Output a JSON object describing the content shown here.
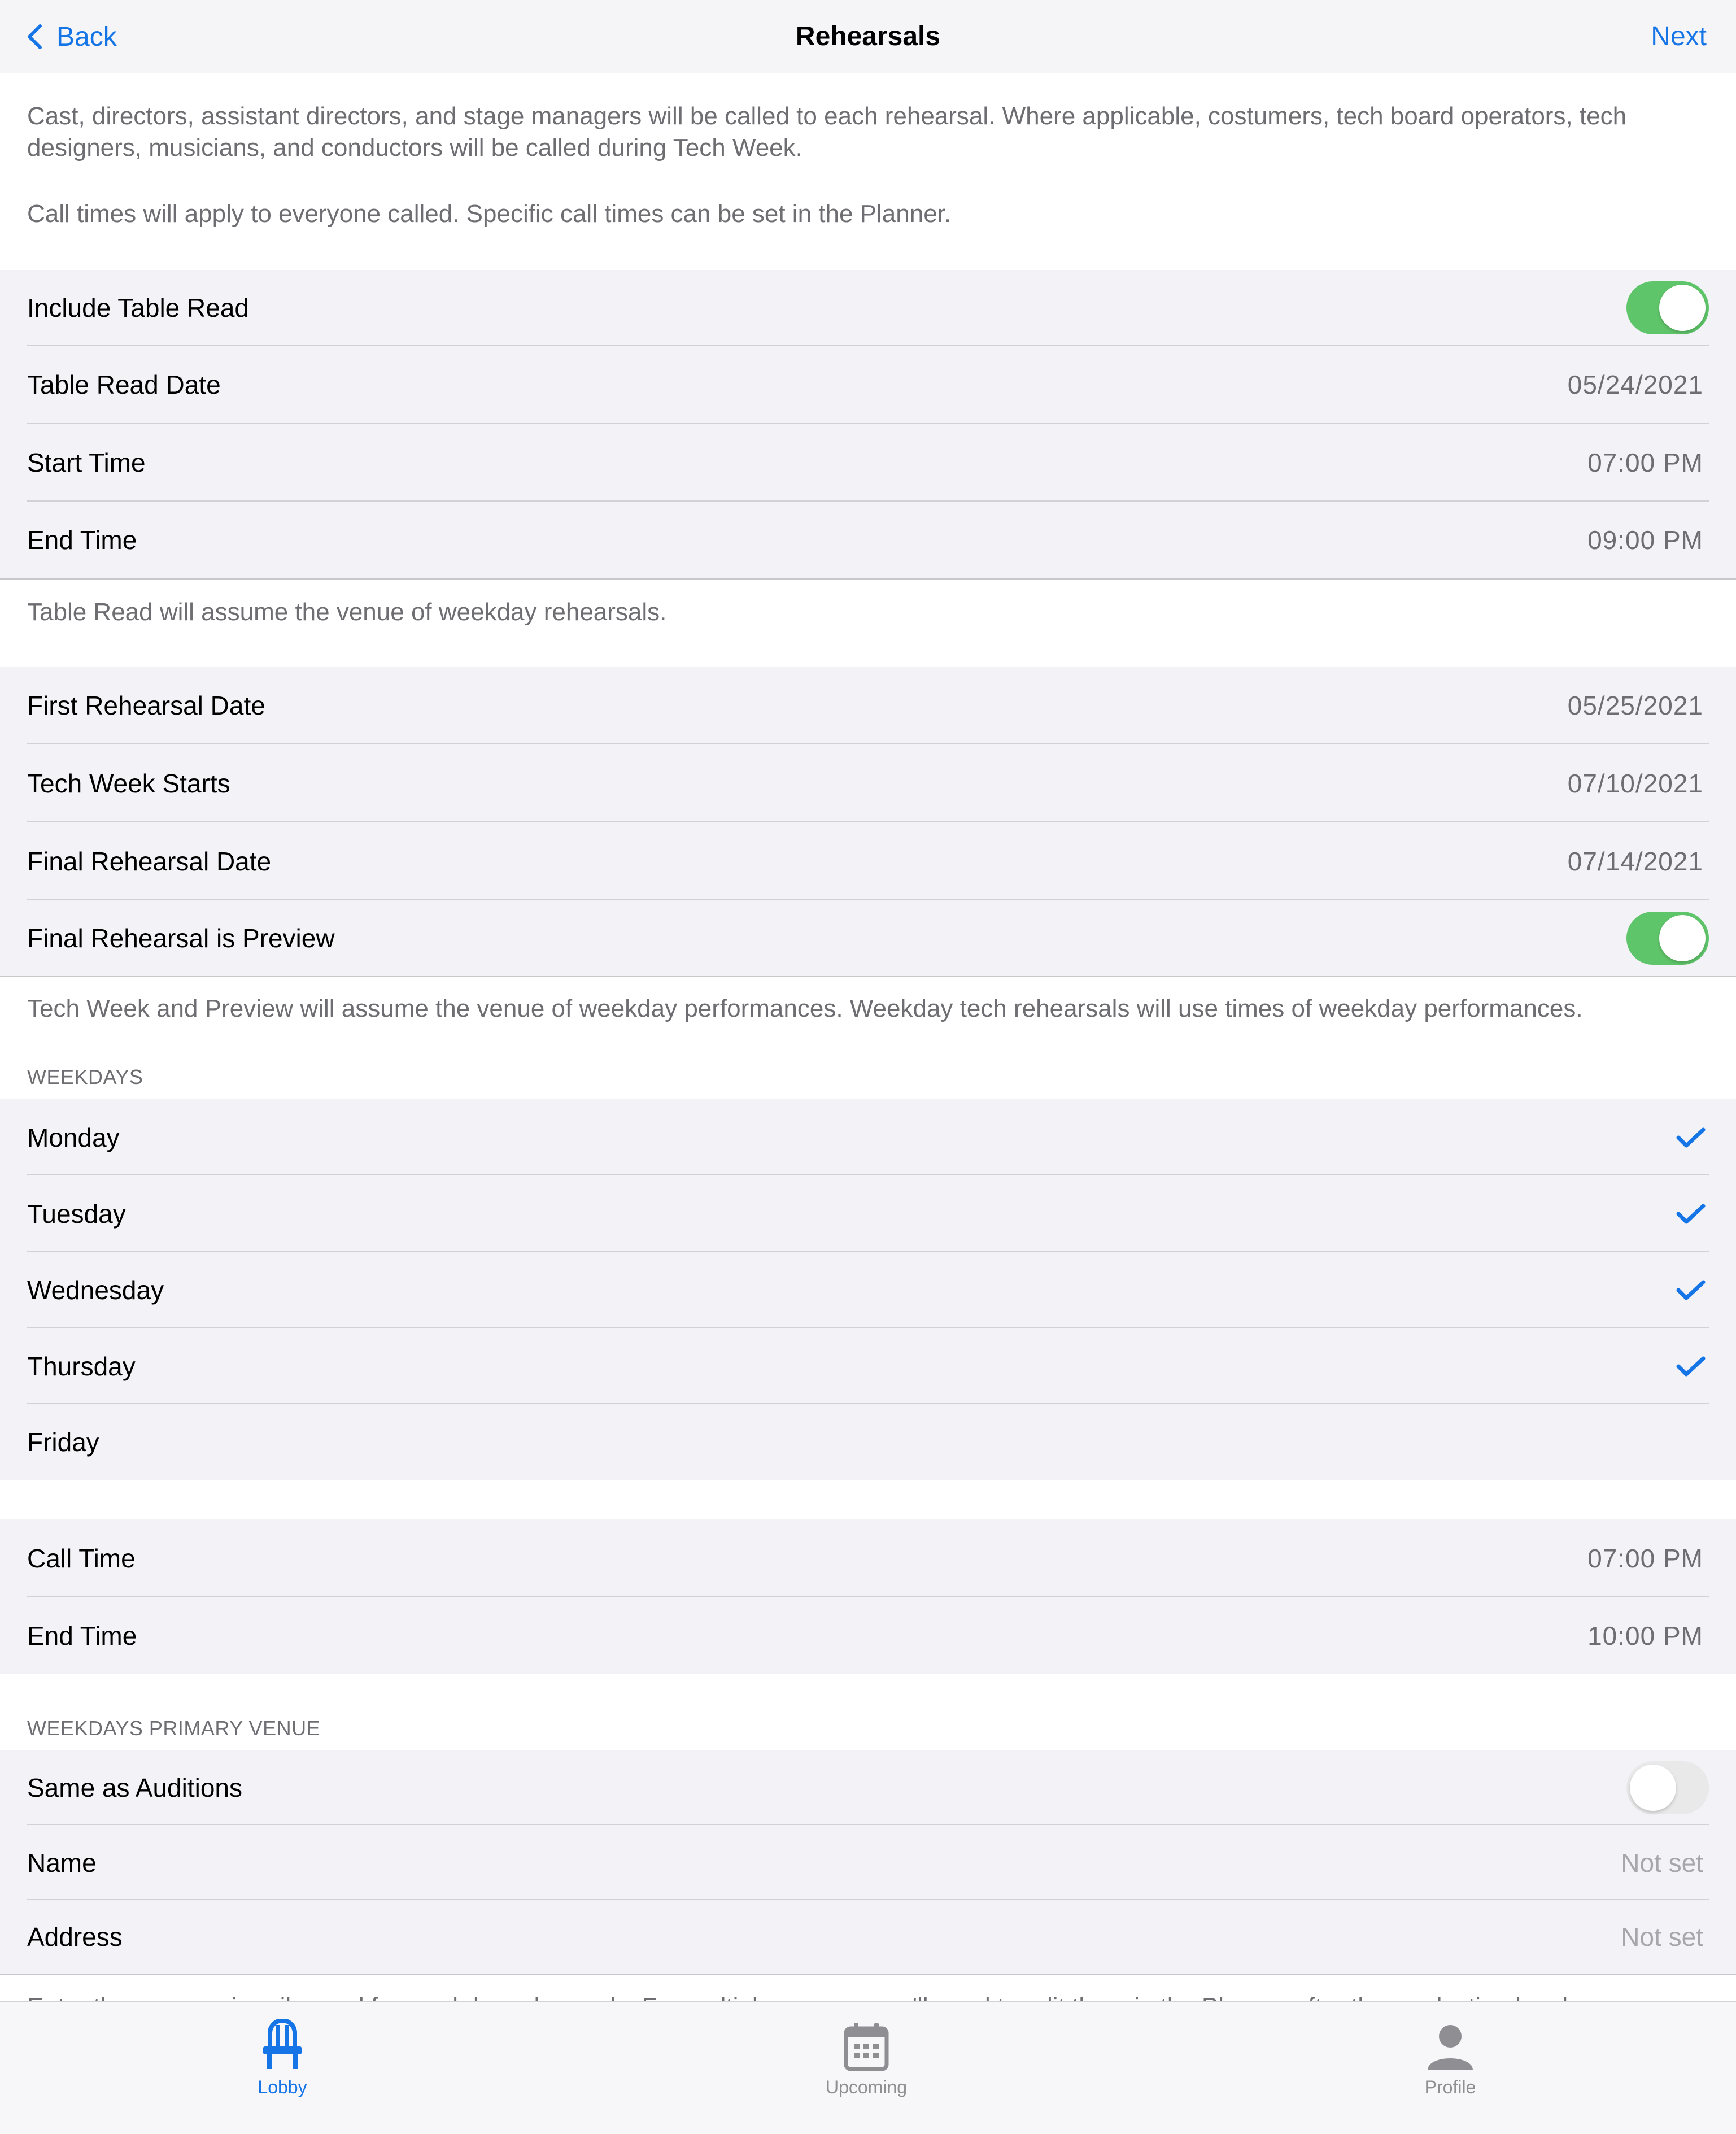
{
  "nav": {
    "back_label": "Back",
    "title": "Rehearsals",
    "next_label": "Next"
  },
  "intro": {
    "paragraph1": "Cast, directors, assistant directors, and stage managers will be called to each rehearsal. Where applicable, costumers, tech board operators, tech designers, musicians, and conductors will be called during Tech Week.",
    "paragraph2": "Call times will apply to everyone called. Specific call times can be set in the Planner."
  },
  "table_read": {
    "include_label": "Include Table Read",
    "include_on": true,
    "date_label": "Table Read Date",
    "date_value": "05/24/2021",
    "start_label": "Start Time",
    "start_value": "07:00 PM",
    "end_label": "End Time",
    "end_value": "09:00 PM",
    "footer": "Table Read will assume the venue of weekday rehearsals."
  },
  "schedule": {
    "first_label": "First Rehearsal Date",
    "first_value": "05/25/2021",
    "tech_label": "Tech Week Starts",
    "tech_value": "07/10/2021",
    "final_label": "Final Rehearsal Date",
    "final_value": "07/14/2021",
    "preview_label": "Final Rehearsal is Preview",
    "preview_on": true,
    "footer": "Tech Week and Preview will assume the venue of weekday performances. Weekday tech rehearsals will use times of weekday performances."
  },
  "weekdays": {
    "header": "WEEKDAYS",
    "days": [
      {
        "label": "Monday",
        "checked": true
      },
      {
        "label": "Tuesday",
        "checked": true
      },
      {
        "label": "Wednesday",
        "checked": true
      },
      {
        "label": "Thursday",
        "checked": true
      },
      {
        "label": "Friday",
        "checked": false
      }
    ]
  },
  "times": {
    "call_label": "Call Time",
    "call_value": "07:00 PM",
    "end_label": "End Time",
    "end_value": "10:00 PM"
  },
  "venue": {
    "header": "WEEKDAYS PRIMARY VENUE",
    "same_label": "Same as Auditions",
    "same_on": false,
    "name_label": "Name",
    "name_value": "Not set",
    "address_label": "Address",
    "address_value": "Not set",
    "footer": "Enter the venue primarily used for weekday rehearsals. For multiple venues, you'll need to edit them in the Planner after the production has been"
  },
  "tabs": [
    {
      "label": "Lobby",
      "icon": "chair-icon",
      "active": true
    },
    {
      "label": "Upcoming",
      "icon": "calendar-icon",
      "active": false
    },
    {
      "label": "Profile",
      "icon": "person-icon",
      "active": false
    }
  ],
  "colors": {
    "accent": "#1575e6",
    "toggle_on": "#5fc56a",
    "cell_background": "#f2f2f7"
  }
}
